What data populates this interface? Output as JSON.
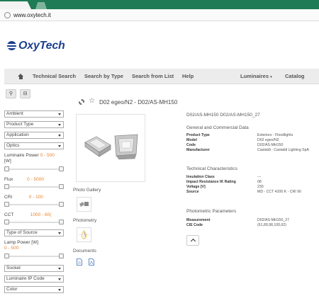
{
  "browser": {
    "url": "www.oxytech.it"
  },
  "brand": {
    "name": "OxyTech",
    "color": "#1d3f8f"
  },
  "nav": {
    "items": [
      "Technical Search",
      "Search by Type",
      "Search from List",
      "Help"
    ],
    "luminaires": "Luminaires",
    "catalog": "Catalog"
  },
  "sidebar": {
    "ambient": "Ambient",
    "product_type": "Product Type",
    "application": "Application",
    "optics": "Optics",
    "luminaire_power": {
      "label": "Luminaire Power",
      "range": "0 - 500",
      "unit": "[W]"
    },
    "flux": {
      "label": "Flux",
      "range": "0 - 5000"
    },
    "cri": {
      "label": "CRI",
      "range": "0 - 100"
    },
    "cct": {
      "label": "CCT",
      "range": "1000 - 60("
    },
    "type_of_source": "Type of Source",
    "lamp_power": {
      "label": "Lamp Power [W]",
      "range": "0 - 500"
    },
    "socket": "Socket",
    "ip_code": "Luminaire IP Code",
    "color": "Color"
  },
  "product": {
    "title": "D02 egeo/N2 - D02/AS-MH150",
    "gallery_label": "Photo Gallery",
    "photometry_label": "Photometry",
    "documents_label": "Documents",
    "details_title": "D02/AS-MH150 D02/AS-MH150_27",
    "general": {
      "heading": "General and Commercial Data",
      "rows": [
        {
          "k": "Product Type",
          "v": "Exteriors - Floodlights"
        },
        {
          "k": "Model",
          "v": "D02 egeo/N2"
        },
        {
          "k": "Code",
          "v": "D02/AS-MH150"
        },
        {
          "k": "Manufacturer",
          "v": "Castaldi - Castaldi Lighting SpA"
        }
      ]
    },
    "technical": {
      "heading": "Technical Characteristics",
      "rows": [
        {
          "k": "Insulation Class",
          "v": "---"
        },
        {
          "k": "Impact Resistance IK Rating",
          "v": "08"
        },
        {
          "k": "Voltage [V]",
          "v": "230"
        },
        {
          "k": "Source",
          "v": "MD - CCT 4200 K - CRI 90"
        }
      ]
    },
    "photometric": {
      "heading": "Photometric Parameters",
      "rows": [
        {
          "k": "Measurement",
          "v": "D02/AS-MH150_27"
        },
        {
          "k": "CIE Code",
          "v": "(61,89,98,100,62)"
        }
      ]
    }
  },
  "colors": {
    "accent_orange": "#e8842c",
    "chrome_green": "#1e7b55"
  }
}
